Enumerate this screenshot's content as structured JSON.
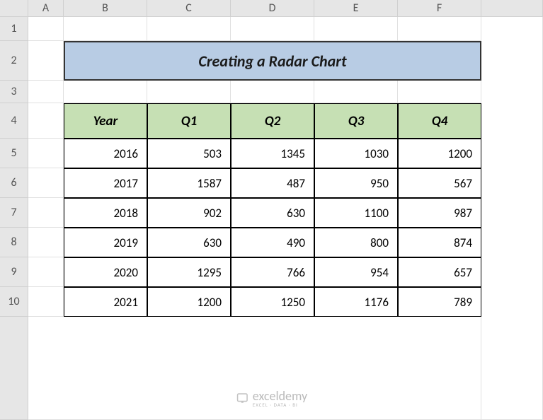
{
  "columns": [
    "A",
    "B",
    "C",
    "D",
    "E",
    "F"
  ],
  "rows": [
    "1",
    "2",
    "3",
    "4",
    "5",
    "6",
    "7",
    "8",
    "9",
    "10"
  ],
  "title": "Creating a Radar Chart",
  "table": {
    "headers": [
      "Year",
      "Q1",
      "Q2",
      "Q3",
      "Q4"
    ],
    "data": [
      [
        "2016",
        "503",
        "1345",
        "1030",
        "1200"
      ],
      [
        "2017",
        "1587",
        "487",
        "950",
        "567"
      ],
      [
        "2018",
        "902",
        "630",
        "1100",
        "987"
      ],
      [
        "2019",
        "630",
        "490",
        "800",
        "874"
      ],
      [
        "2020",
        "1295",
        "766",
        "954",
        "657"
      ],
      [
        "2021",
        "1200",
        "1250",
        "1176",
        "789"
      ]
    ]
  },
  "watermark": {
    "text": "exceldemy",
    "sub": "EXCEL · DATA · BI"
  },
  "chart_data": {
    "type": "table",
    "title": "Creating a Radar Chart",
    "columns": [
      "Year",
      "Q1",
      "Q2",
      "Q3",
      "Q4"
    ],
    "rows": [
      {
        "Year": 2016,
        "Q1": 503,
        "Q2": 1345,
        "Q3": 1030,
        "Q4": 1200
      },
      {
        "Year": 2017,
        "Q1": 1587,
        "Q2": 487,
        "Q3": 950,
        "Q4": 567
      },
      {
        "Year": 2018,
        "Q1": 902,
        "Q2": 630,
        "Q3": 1100,
        "Q4": 987
      },
      {
        "Year": 2019,
        "Q1": 630,
        "Q2": 490,
        "Q3": 800,
        "Q4": 874
      },
      {
        "Year": 2020,
        "Q1": 1295,
        "Q2": 766,
        "Q3": 954,
        "Q4": 657
      },
      {
        "Year": 2021,
        "Q1": 1200,
        "Q2": 1250,
        "Q3": 1176,
        "Q4": 789
      }
    ]
  }
}
